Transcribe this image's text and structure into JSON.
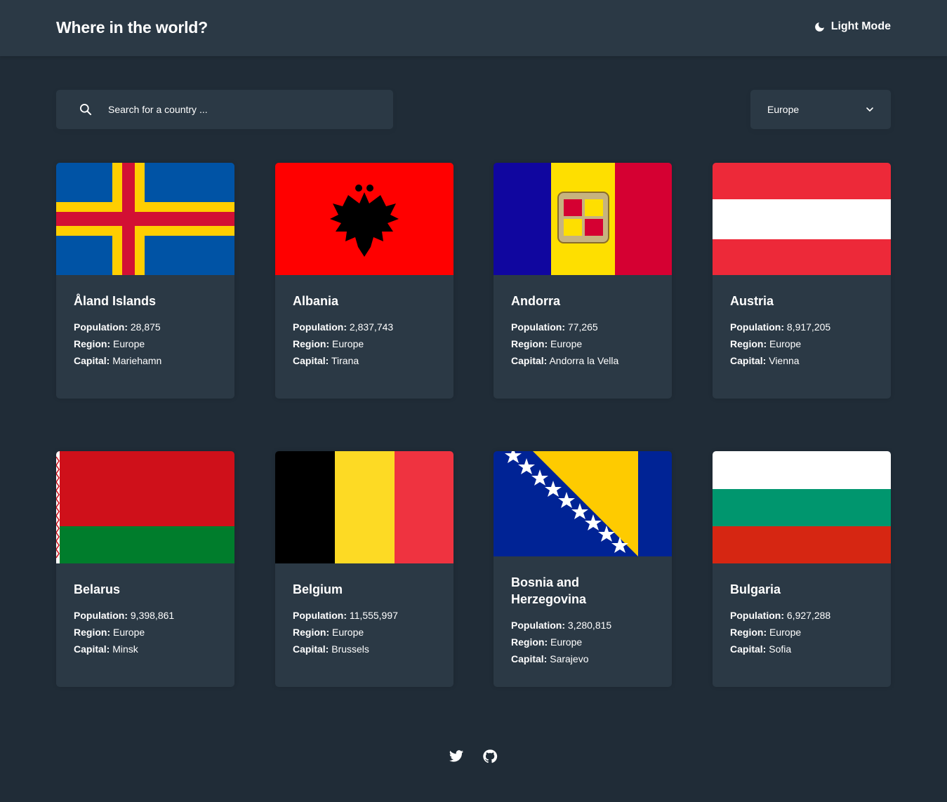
{
  "header": {
    "title": "Where in the world?",
    "mode_label": "Light Mode"
  },
  "search": {
    "placeholder": "Search for a country ..."
  },
  "filter": {
    "selected": "Europe"
  },
  "labels": {
    "population": "Population:",
    "region": "Region:",
    "capital": "Capital:"
  },
  "countries": [
    {
      "name": "Åland Islands",
      "population": "28,875",
      "region": "Europe",
      "capital": "Mariehamn"
    },
    {
      "name": "Albania",
      "population": "2,837,743",
      "region": "Europe",
      "capital": "Tirana"
    },
    {
      "name": "Andorra",
      "population": "77,265",
      "region": "Europe",
      "capital": "Andorra la Vella"
    },
    {
      "name": "Austria",
      "population": "8,917,205",
      "region": "Europe",
      "capital": "Vienna"
    },
    {
      "name": "Belarus",
      "population": "9,398,861",
      "region": "Europe",
      "capital": "Minsk"
    },
    {
      "name": "Belgium",
      "population": "11,555,997",
      "region": "Europe",
      "capital": "Brussels"
    },
    {
      "name": "Bosnia and Herzegovina",
      "population": "3,280,815",
      "region": "Europe",
      "capital": "Sarajevo"
    },
    {
      "name": "Bulgaria",
      "population": "6,927,288",
      "region": "Europe",
      "capital": "Sofia"
    }
  ],
  "footer": {
    "icons": [
      "twitter-icon",
      "github-icon"
    ]
  },
  "colors": {
    "background": "#202c37",
    "surface": "#2b3945",
    "text": "#ffffff"
  }
}
